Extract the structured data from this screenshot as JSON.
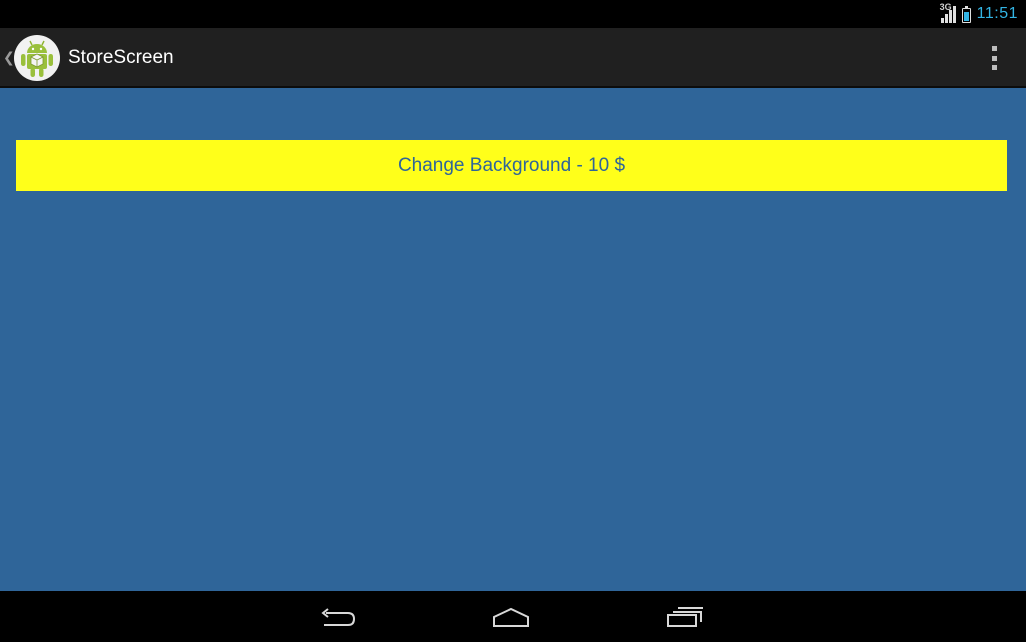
{
  "status_bar": {
    "network_type": "3G",
    "time": "11:51"
  },
  "action_bar": {
    "title": "StoreScreen",
    "app_icon": "android-robot-icon",
    "overflow_icon": "overflow-menu-icon"
  },
  "content": {
    "background_color": "#2f6599",
    "store_item_button": {
      "label": "Change Background - 10 $",
      "background_color": "#ffff1a",
      "text_color": "#2f6599"
    }
  },
  "navigation_bar": {
    "back_icon": "back-icon",
    "home_icon": "home-icon",
    "recents_icon": "recents-icon"
  }
}
